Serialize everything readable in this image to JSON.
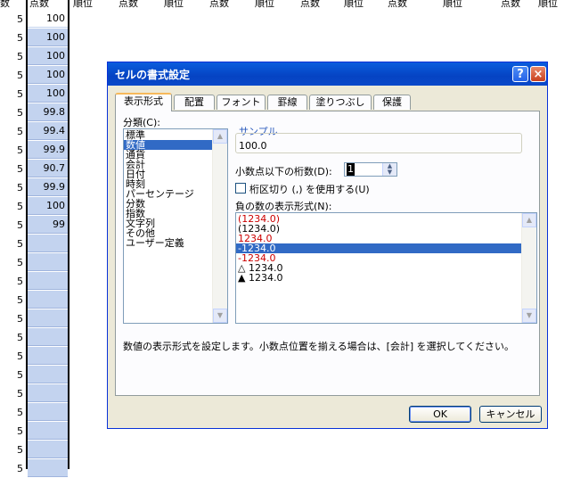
{
  "sheet": {
    "headers": [
      "点数",
      "順位",
      "点数",
      "順位",
      "点数",
      "順位",
      "点数",
      "順位",
      "点数",
      "順位",
      "点数",
      "順位"
    ],
    "left_partial_header": "数",
    "colA_value": "5",
    "colB_values": [
      "100",
      "100",
      "100",
      "100",
      "100",
      "99.8",
      "99.4",
      "99.9",
      "90.7",
      "99.9",
      "100",
      "99"
    ]
  },
  "dialog": {
    "title": "セルの書式設定",
    "help_glyph": "?",
    "close_glyph": "×",
    "tabs": [
      "表示形式",
      "配置",
      "フォント",
      "罫線",
      "塗りつぶし",
      "保護"
    ],
    "category_label": "分類(C):",
    "categories": [
      "標準",
      "数値",
      "通貨",
      "会計",
      "日付",
      "時刻",
      "パーセンテージ",
      "分数",
      "指数",
      "文字列",
      "その他",
      "ユーザー定義"
    ],
    "selected_category": "数値",
    "sample_label": "サンプル",
    "sample_value": "100.0",
    "decimal_label": "小数点以下の桁数(D):",
    "decimal_value": "1",
    "thousands_label": "桁区切り (,) を使用する(U)",
    "negative_label": "負の数の表示形式(N):",
    "negative_formats": [
      {
        "text": "(1234.0)",
        "color": "#cc0000"
      },
      {
        "text": "(1234.0)",
        "color": "#000000"
      },
      {
        "text": "1234.0",
        "color": "#cc0000"
      },
      {
        "text": "-1234.0",
        "color": "#ffffff",
        "selected": true
      },
      {
        "text": "-1234.0",
        "color": "#cc0000"
      },
      {
        "text": "△ 1234.0",
        "color": "#000000"
      },
      {
        "text": "▲ 1234.0",
        "color": "#000000"
      }
    ],
    "description": "数値の表示形式を設定します。小数点位置を揃える場合は、[会計] を選択してください。",
    "ok_label": "OK",
    "cancel_label": "キャンセル"
  }
}
